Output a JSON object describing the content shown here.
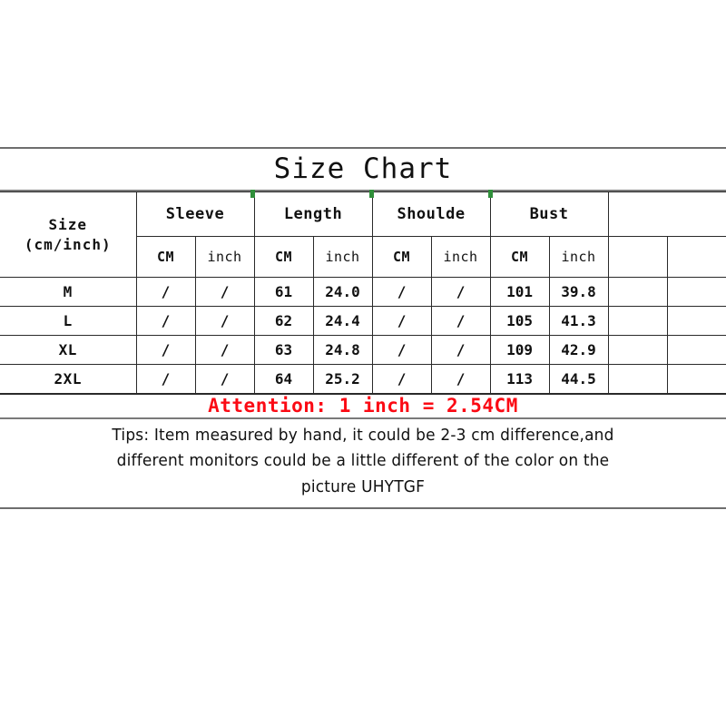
{
  "chart": {
    "title": "Size Chart",
    "size_header": {
      "line1": "Size",
      "line2": "(cm/inch)"
    },
    "group_headers": [
      "Sleeve",
      "Length",
      "Shoulde",
      "Bust",
      ""
    ],
    "unit_headers": [
      "CM",
      "inch",
      "CM",
      "inch",
      "CM",
      "inch",
      "CM",
      "inch",
      "",
      ""
    ],
    "rows": [
      {
        "size": "M",
        "values": [
          "/",
          "/",
          "61",
          "24.0",
          "/",
          "/",
          "101",
          "39.8",
          "",
          ""
        ]
      },
      {
        "size": "L",
        "values": [
          "/",
          "/",
          "62",
          "24.4",
          "/",
          "/",
          "105",
          "41.3",
          "",
          ""
        ]
      },
      {
        "size": "XL",
        "values": [
          "/",
          "/",
          "63",
          "24.8",
          "/",
          "/",
          "109",
          "42.9",
          "",
          ""
        ]
      },
      {
        "size": "2XL",
        "values": [
          "/",
          "/",
          "64",
          "25.2",
          "/",
          "/",
          "113",
          "44.5",
          "",
          ""
        ]
      }
    ],
    "attention": "Attention: 1 inch = 2.54CM",
    "tips": [
      "Tips: Item measured by hand,  it could be 2-3 cm difference,and",
      "different monitors could be a little different of the color on the",
      "picture UHYTGF"
    ],
    "colors": {
      "unit_red": "#e00511",
      "attention_red": "#fb0a14",
      "text": "#111111",
      "border": "#2a2a2a",
      "outer_border": "#6e6e6e",
      "accent_green": "#2f8f3a"
    }
  },
  "chart_data": {
    "type": "table",
    "title": "Size Chart",
    "categories": [
      "M",
      "L",
      "XL",
      "2XL"
    ],
    "columns": [
      "Size (cm/inch)",
      "Sleeve CM",
      "Sleeve inch",
      "Length CM",
      "Length inch",
      "Shoulde CM",
      "Shoulde inch",
      "Bust CM",
      "Bust inch"
    ],
    "series": [
      {
        "name": "Sleeve CM",
        "values": [
          "/",
          "/",
          "/",
          "/"
        ]
      },
      {
        "name": "Sleeve inch",
        "values": [
          "/",
          "/",
          "/",
          "/"
        ]
      },
      {
        "name": "Length CM",
        "values": [
          61,
          62,
          63,
          64
        ]
      },
      {
        "name": "Length inch",
        "values": [
          24.0,
          24.4,
          24.8,
          25.2
        ]
      },
      {
        "name": "Shoulde CM",
        "values": [
          "/",
          "/",
          "/",
          "/"
        ]
      },
      {
        "name": "Shoulde inch",
        "values": [
          "/",
          "/",
          "/",
          "/"
        ]
      },
      {
        "name": "Bust CM",
        "values": [
          101,
          105,
          109,
          113
        ]
      },
      {
        "name": "Bust inch",
        "values": [
          39.8,
          41.3,
          42.9,
          44.5
        ]
      }
    ],
    "xlabel": "",
    "ylabel": "",
    "notes": [
      "Attention: 1 inch = 2.54CM",
      "Tips: Item measured by hand,  it could be 2-3 cm difference,and different monitors could be a little different of the color on the picture UHYTGF"
    ]
  }
}
